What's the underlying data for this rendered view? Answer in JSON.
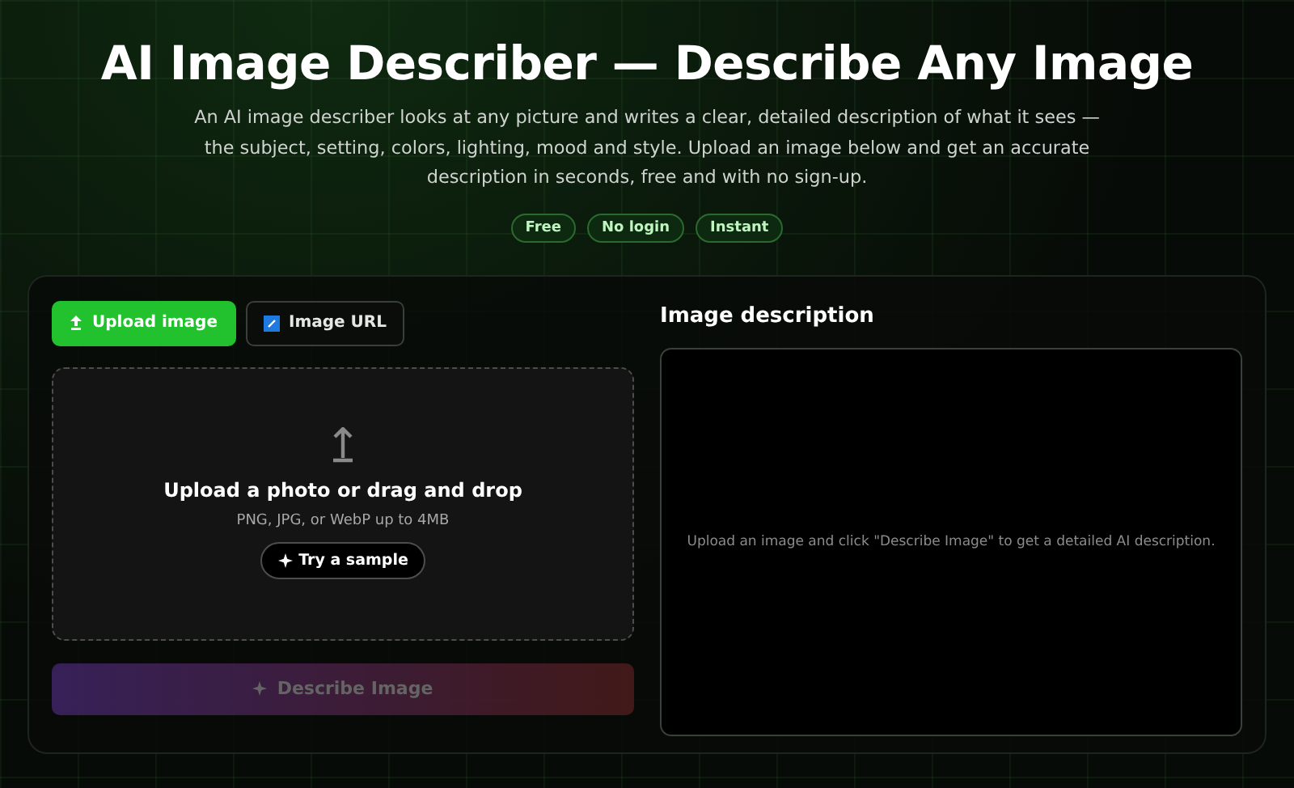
{
  "header": {
    "title": "AI Image Describer — Describe Any Image",
    "description": "An AI image describer looks at any picture and writes a clear, detailed description of what it sees — the subject, setting, colors, lighting, mood and style. Upload an image below and get an accurate description in seconds, free and with no sign-up."
  },
  "badges": [
    "Free",
    "No login",
    "Instant"
  ],
  "tabs": [
    {
      "label": "Upload image",
      "selected": true,
      "kind": "upload"
    },
    {
      "label": "Image URL",
      "selected": false,
      "kind": "url"
    }
  ],
  "dropzone": {
    "title": "Upload a photo or drag and drop",
    "hint": "PNG, JPG, or WebP up to 4MB",
    "sample_button": "Try a sample"
  },
  "describe_button": {
    "label": "Describe Image",
    "disabled": true
  },
  "output": {
    "heading": "Image description",
    "placeholder": "Upload an image and click \"Describe Image\" to get a detailed AI description."
  }
}
